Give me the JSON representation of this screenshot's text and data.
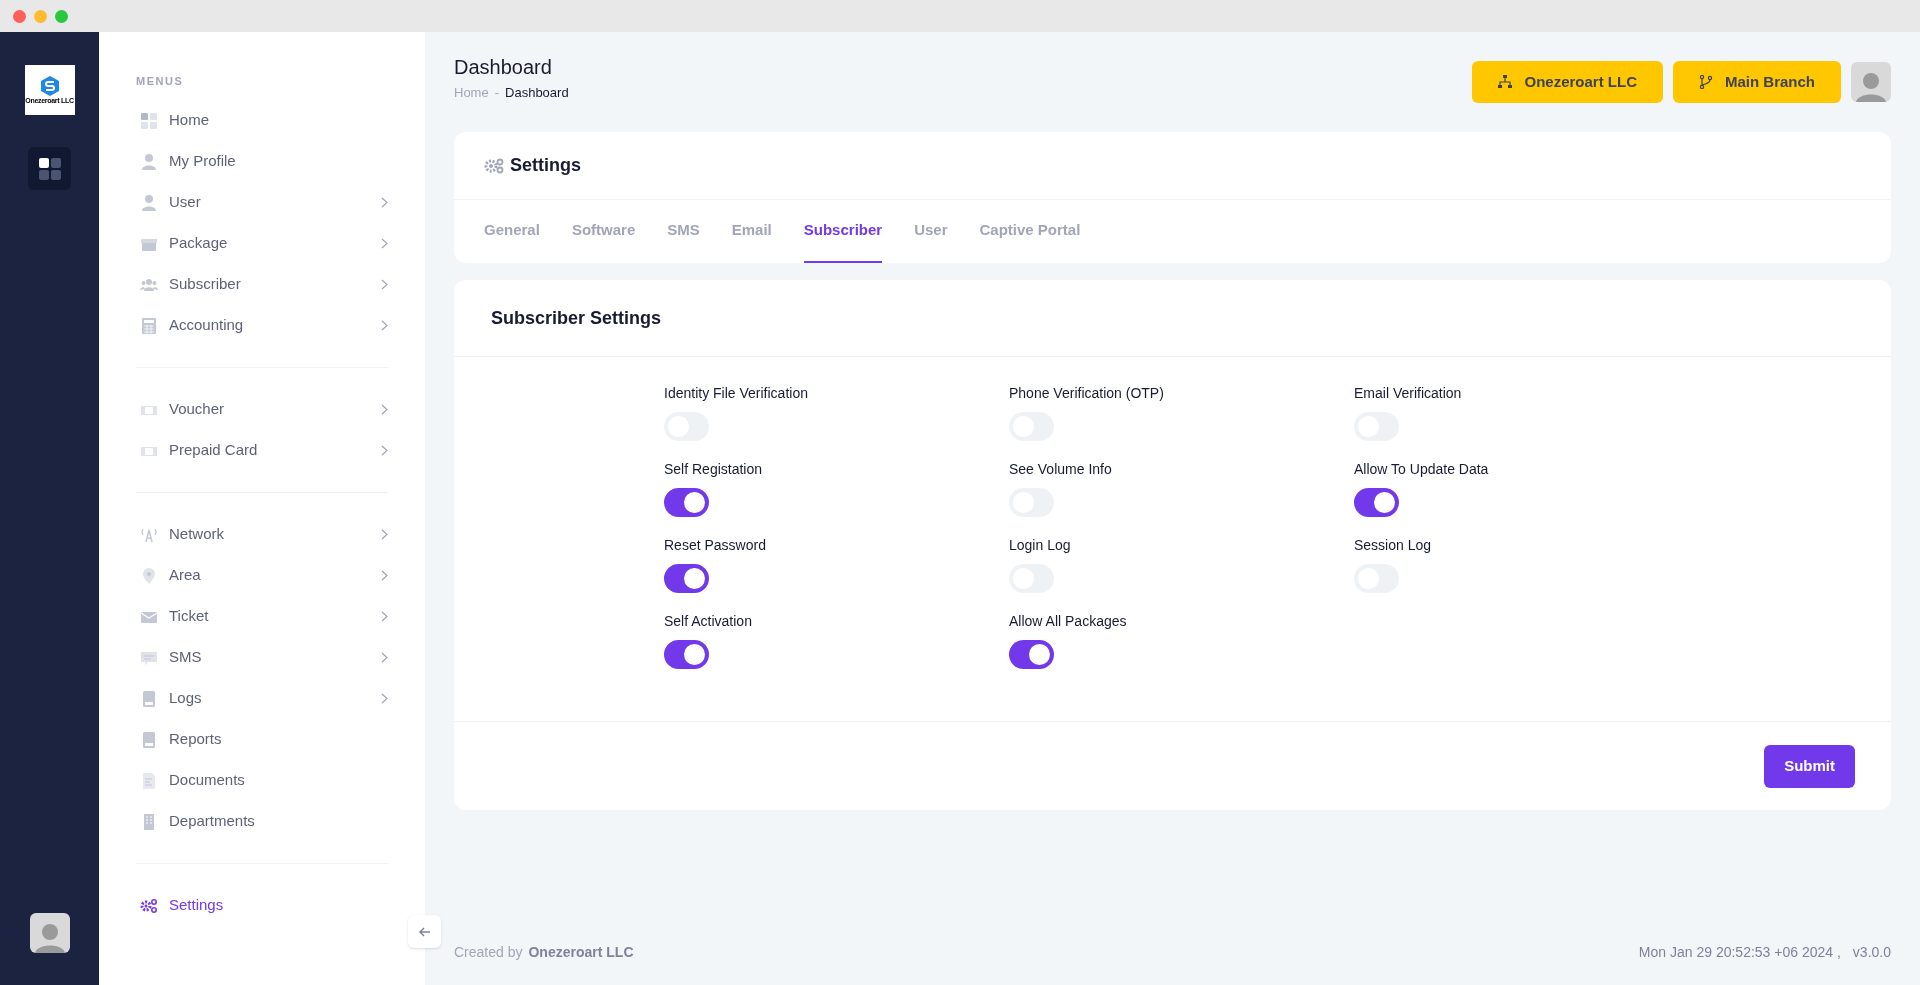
{
  "app_logo": {
    "text": "Onezeroart LLC"
  },
  "sidebar": {
    "heading": "MENUS",
    "groups": [
      [
        {
          "label": "Home",
          "has_submenu": false,
          "selected": false
        },
        {
          "label": "My Profile",
          "has_submenu": false,
          "selected": false
        },
        {
          "label": "User",
          "has_submenu": true,
          "selected": false
        },
        {
          "label": "Package",
          "has_submenu": true,
          "selected": false
        },
        {
          "label": "Subscriber",
          "has_submenu": true,
          "selected": false
        },
        {
          "label": "Accounting",
          "has_submenu": true,
          "selected": false
        }
      ],
      [
        {
          "label": "Voucher",
          "has_submenu": true,
          "selected": false
        },
        {
          "label": "Prepaid Card",
          "has_submenu": true,
          "selected": false
        }
      ],
      [
        {
          "label": "Network",
          "has_submenu": true,
          "selected": false
        },
        {
          "label": "Area",
          "has_submenu": true,
          "selected": false
        },
        {
          "label": "Ticket",
          "has_submenu": true,
          "selected": false
        },
        {
          "label": "SMS",
          "has_submenu": true,
          "selected": false
        },
        {
          "label": "Logs",
          "has_submenu": true,
          "selected": false
        },
        {
          "label": "Reports",
          "has_submenu": false,
          "selected": false
        },
        {
          "label": "Documents",
          "has_submenu": false,
          "selected": false
        },
        {
          "label": "Departments",
          "has_submenu": false,
          "selected": false
        }
      ],
      [
        {
          "label": "Settings",
          "has_submenu": false,
          "selected": true
        }
      ]
    ]
  },
  "header": {
    "title": "Dashboard",
    "breadcrumb": [
      "Home",
      "Dashboard"
    ],
    "breadcrumb_separator": "-",
    "buttons": [
      {
        "label": "Onezeroart LLC"
      },
      {
        "label": "Main Branch"
      }
    ]
  },
  "settings_card": {
    "title": "Settings",
    "tabs": [
      {
        "label": "General",
        "selected": false
      },
      {
        "label": "Software",
        "selected": false
      },
      {
        "label": "SMS",
        "selected": false
      },
      {
        "label": "Email",
        "selected": false
      },
      {
        "label": "Subscriber",
        "selected": true
      },
      {
        "label": "User",
        "selected": false
      },
      {
        "label": "Captive Portal",
        "selected": false
      }
    ]
  },
  "subscriber_settings": {
    "title": "Subscriber Settings",
    "toggles": [
      {
        "label": "Identity File Verification",
        "on": false
      },
      {
        "label": "Phone Verification (OTP)",
        "on": false
      },
      {
        "label": "Email Verification",
        "on": false
      },
      {
        "label": "Self Registation",
        "on": true
      },
      {
        "label": "See Volume Info",
        "on": false
      },
      {
        "label": "Allow To Update Data",
        "on": true
      },
      {
        "label": "Reset Password",
        "on": true
      },
      {
        "label": "Login Log",
        "on": false
      },
      {
        "label": "Session Log",
        "on": false
      },
      {
        "label": "Self Activation",
        "on": true
      },
      {
        "label": "Allow All Packages",
        "on": true
      }
    ],
    "submit": "Submit"
  },
  "footer": {
    "created_by": "Created by",
    "company": "Onezeroart LLC",
    "timestamp": "Mon Jan 29 20:52:53 +06 2024 ,",
    "version": "v3.0.0"
  }
}
